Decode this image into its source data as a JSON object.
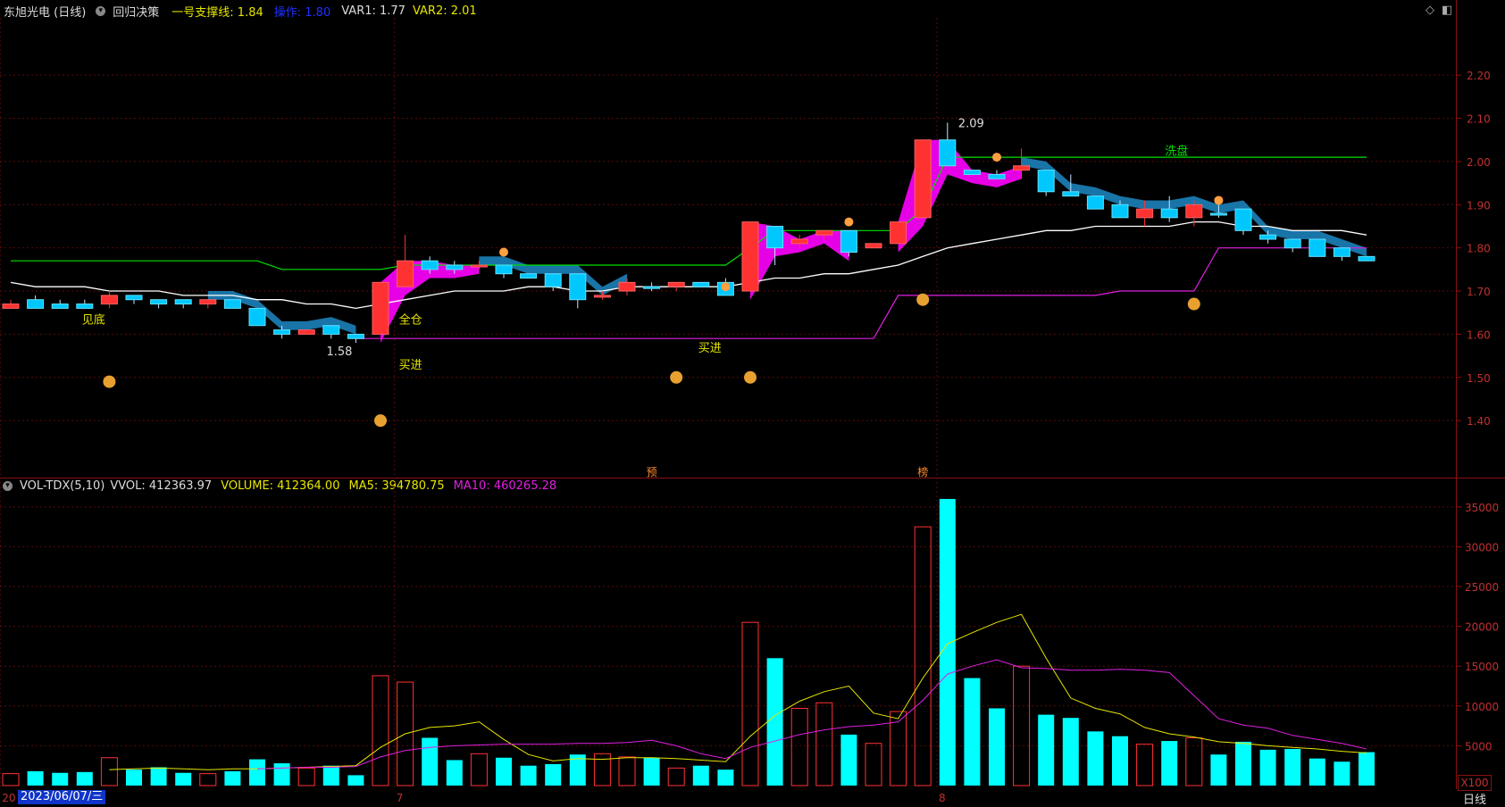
{
  "top_header": {
    "stock_name": "东旭光电 (日线)",
    "indicator": "回归决策",
    "support_label": "一号支撑线: 1.84",
    "operate_label": "操作: 1.80",
    "var1_label": "VAR1: 1.77",
    "var2_label": "VAR2: 2.01"
  },
  "bottom_header": {
    "indicator": "VOL-TDX(5,10)",
    "vvol_label": "VVOL: 412363.97",
    "volume_label": "VOLUME: 412364.00",
    "ma5_label": "MA5: 394780.75",
    "ma10_label": "MA10: 460265.28"
  },
  "price_axis": [
    "2.20",
    "2.10",
    "2.00",
    "1.90",
    "1.80",
    "1.70",
    "1.60",
    "1.50",
    "1.40"
  ],
  "volume_axis": [
    "35000",
    "30000",
    "25000",
    "20000",
    "15000",
    "10000",
    "5000"
  ],
  "annotations": {
    "high_label": "2.09",
    "low_label": "1.58",
    "see_bottom": "见底",
    "full_position": "全仓",
    "buy_in_1": "买进",
    "buy_in_2": "买进",
    "wash": "洗盘",
    "pre_marker": "预",
    "list_marker": "榜"
  },
  "month_marks": [
    "20",
    "7",
    "8"
  ],
  "cursor_date": "2023/06/07/三",
  "scale_label": "X100",
  "period_label": "日线",
  "colors": {
    "up": "#ff3232",
    "down": "#00c8ff",
    "ma5": "#e6e600",
    "ma10": "#e020e0",
    "support": "#00e000",
    "var": "#ffffff",
    "fill": "#ff00ff",
    "band": "#1a7ab0"
  },
  "chart_data": [
    {
      "type": "candlestick",
      "title": "",
      "ylim": [
        1.33,
        2.25
      ],
      "candles": [
        {
          "o": 1.66,
          "h": 1.68,
          "l": 1.66,
          "c": 1.67,
          "up": true
        },
        {
          "o": 1.68,
          "h": 1.69,
          "l": 1.66,
          "c": 1.66,
          "up": false
        },
        {
          "o": 1.67,
          "h": 1.68,
          "l": 1.66,
          "c": 1.66,
          "up": false
        },
        {
          "o": 1.67,
          "h": 1.68,
          "l": 1.66,
          "c": 1.66,
          "up": false
        },
        {
          "o": 1.67,
          "h": 1.7,
          "l": 1.66,
          "c": 1.69,
          "up": true
        },
        {
          "o": 1.69,
          "h": 1.69,
          "l": 1.67,
          "c": 1.68,
          "up": false
        },
        {
          "o": 1.68,
          "h": 1.68,
          "l": 1.66,
          "c": 1.67,
          "up": false
        },
        {
          "o": 1.68,
          "h": 1.68,
          "l": 1.66,
          "c": 1.67,
          "up": false
        },
        {
          "o": 1.67,
          "h": 1.68,
          "l": 1.66,
          "c": 1.68,
          "up": true
        },
        {
          "o": 1.68,
          "h": 1.68,
          "l": 1.66,
          "c": 1.66,
          "up": false
        },
        {
          "o": 1.66,
          "h": 1.66,
          "l": 1.62,
          "c": 1.62,
          "up": false
        },
        {
          "o": 1.61,
          "h": 1.62,
          "l": 1.59,
          "c": 1.6,
          "up": false
        },
        {
          "o": 1.6,
          "h": 1.61,
          "l": 1.6,
          "c": 1.61,
          "up": true
        },
        {
          "o": 1.62,
          "h": 1.62,
          "l": 1.59,
          "c": 1.6,
          "up": false
        },
        {
          "o": 1.6,
          "h": 1.6,
          "l": 1.58,
          "c": 1.59,
          "up": false
        },
        {
          "o": 1.6,
          "h": 1.72,
          "l": 1.6,
          "c": 1.72,
          "up": true
        },
        {
          "o": 1.71,
          "h": 1.83,
          "l": 1.71,
          "c": 1.77,
          "up": true
        },
        {
          "o": 1.77,
          "h": 1.78,
          "l": 1.74,
          "c": 1.75,
          "up": false
        },
        {
          "o": 1.76,
          "h": 1.77,
          "l": 1.74,
          "c": 1.75,
          "up": false
        },
        {
          "o": 1.76,
          "h": 1.77,
          "l": 1.75,
          "c": 1.76,
          "up": true
        },
        {
          "o": 1.76,
          "h": 1.76,
          "l": 1.73,
          "c": 1.74,
          "up": false
        },
        {
          "o": 1.74,
          "h": 1.74,
          "l": 1.73,
          "c": 1.73,
          "up": false
        },
        {
          "o": 1.74,
          "h": 1.74,
          "l": 1.7,
          "c": 1.71,
          "up": false
        },
        {
          "o": 1.74,
          "h": 1.74,
          "l": 1.66,
          "c": 1.68,
          "up": false
        },
        {
          "o": 1.69,
          "h": 1.7,
          "l": 1.68,
          "c": 1.69,
          "up": true
        },
        {
          "o": 1.7,
          "h": 1.73,
          "l": 1.69,
          "c": 1.72,
          "up": true
        },
        {
          "o": 1.71,
          "h": 1.72,
          "l": 1.7,
          "c": 1.71,
          "up": false
        },
        {
          "o": 1.71,
          "h": 1.72,
          "l": 1.7,
          "c": 1.72,
          "up": true
        },
        {
          "o": 1.72,
          "h": 1.72,
          "l": 1.71,
          "c": 1.71,
          "up": false
        },
        {
          "o": 1.72,
          "h": 1.73,
          "l": 1.69,
          "c": 1.69,
          "up": false
        },
        {
          "o": 1.7,
          "h": 1.86,
          "l": 1.7,
          "c": 1.86,
          "up": true
        },
        {
          "o": 1.85,
          "h": 1.85,
          "l": 1.76,
          "c": 1.8,
          "up": false
        },
        {
          "o": 1.81,
          "h": 1.83,
          "l": 1.8,
          "c": 1.82,
          "up": true
        },
        {
          "o": 1.83,
          "h": 1.84,
          "l": 1.82,
          "c": 1.84,
          "up": true
        },
        {
          "o": 1.84,
          "h": 1.84,
          "l": 1.78,
          "c": 1.79,
          "up": false
        },
        {
          "o": 1.8,
          "h": 1.81,
          "l": 1.8,
          "c": 1.81,
          "up": true
        },
        {
          "o": 1.81,
          "h": 1.86,
          "l": 1.81,
          "c": 1.86,
          "up": true
        },
        {
          "o": 1.87,
          "h": 2.05,
          "l": 1.87,
          "c": 2.05,
          "up": true
        },
        {
          "o": 2.05,
          "h": 2.09,
          "l": 1.99,
          "c": 1.99,
          "up": false
        },
        {
          "o": 1.98,
          "h": 1.98,
          "l": 1.97,
          "c": 1.97,
          "up": false
        },
        {
          "o": 1.97,
          "h": 1.98,
          "l": 1.96,
          "c": 1.96,
          "up": false
        },
        {
          "o": 1.99,
          "h": 2.03,
          "l": 1.96,
          "c": 1.98,
          "up": true
        },
        {
          "o": 1.98,
          "h": 1.98,
          "l": 1.92,
          "c": 1.93,
          "up": false
        },
        {
          "o": 1.93,
          "h": 1.97,
          "l": 1.92,
          "c": 1.92,
          "up": false
        },
        {
          "o": 1.92,
          "h": 1.92,
          "l": 1.89,
          "c": 1.89,
          "up": false
        },
        {
          "o": 1.9,
          "h": 1.91,
          "l": 1.87,
          "c": 1.87,
          "up": false
        },
        {
          "o": 1.89,
          "h": 1.91,
          "l": 1.85,
          "c": 1.87,
          "up": true
        },
        {
          "o": 1.89,
          "h": 1.92,
          "l": 1.86,
          "c": 1.87,
          "up": false
        },
        {
          "o": 1.9,
          "h": 1.91,
          "l": 1.85,
          "c": 1.87,
          "up": true
        },
        {
          "o": 1.88,
          "h": 1.9,
          "l": 1.87,
          "c": 1.88,
          "up": false
        },
        {
          "o": 1.89,
          "h": 1.89,
          "l": 1.83,
          "c": 1.84,
          "up": false
        },
        {
          "o": 1.83,
          "h": 1.84,
          "l": 1.81,
          "c": 1.82,
          "up": false
        },
        {
          "o": 1.82,
          "h": 1.82,
          "l": 1.79,
          "c": 1.8,
          "up": false
        },
        {
          "o": 1.82,
          "h": 1.82,
          "l": 1.78,
          "c": 1.78,
          "up": false
        },
        {
          "o": 1.8,
          "h": 1.8,
          "l": 1.77,
          "c": 1.78,
          "up": false
        },
        {
          "o": 1.78,
          "h": 1.78,
          "l": 1.77,
          "c": 1.77,
          "up": false
        }
      ],
      "support_line": [
        1.77,
        1.77,
        1.77,
        1.77,
        1.77,
        1.77,
        1.77,
        1.77,
        1.77,
        1.77,
        1.77,
        1.75,
        1.75,
        1.75,
        1.75,
        1.75,
        1.76,
        1.76,
        1.76,
        1.76,
        1.76,
        1.76,
        1.76,
        1.76,
        1.76,
        1.76,
        1.76,
        1.76,
        1.76,
        1.76,
        1.8,
        1.84,
        1.84,
        1.84,
        1.84,
        1.84,
        1.84,
        1.89,
        2.01,
        2.01,
        2.01,
        2.01,
        2.01,
        2.01,
        2.01,
        2.01,
        2.01,
        2.01,
        2.01,
        2.01,
        2.01,
        2.01,
        2.01,
        2.01,
        2.01,
        2.01
      ],
      "operate_line": [
        1.72,
        1.71,
        1.71,
        1.71,
        1.7,
        1.7,
        1.7,
        1.69,
        1.69,
        1.69,
        1.68,
        1.68,
        1.67,
        1.67,
        1.66,
        1.67,
        1.68,
        1.69,
        1.7,
        1.7,
        1.7,
        1.71,
        1.71,
        1.7,
        1.7,
        1.71,
        1.71,
        1.71,
        1.71,
        1.71,
        1.72,
        1.73,
        1.73,
        1.74,
        1.74,
        1.75,
        1.76,
        1.78,
        1.8,
        1.81,
        1.82,
        1.83,
        1.84,
        1.84,
        1.85,
        1.85,
        1.85,
        1.85,
        1.86,
        1.86,
        1.85,
        1.85,
        1.84,
        1.84,
        1.84,
        1.83
      ],
      "bottom_line": [
        null,
        null,
        null,
        null,
        null,
        null,
        null,
        null,
        null,
        null,
        null,
        null,
        null,
        null,
        1.59,
        1.59,
        1.59,
        1.59,
        1.59,
        1.59,
        1.59,
        1.59,
        1.59,
        1.59,
        1.59,
        1.59,
        1.59,
        1.59,
        1.59,
        1.59,
        1.59,
        1.59,
        1.59,
        1.59,
        1.59,
        1.59,
        1.69,
        1.69,
        1.69,
        1.69,
        1.69,
        1.69,
        1.69,
        1.69,
        1.69,
        1.7,
        1.7,
        1.7,
        1.7,
        1.8,
        1.8,
        1.8,
        1.8,
        1.8,
        1.8,
        1.8
      ]
    },
    {
      "type": "bar",
      "title": "VOL-TDX(5,10)",
      "ylim": [
        0,
        37000
      ],
      "volume": [
        1500,
        1800,
        1600,
        1700,
        3500,
        2000,
        2300,
        1600,
        1500,
        1800,
        3300,
        2800,
        2200,
        2500,
        1300,
        13800,
        13000,
        6000,
        3200,
        4000,
        3500,
        2500,
        2700,
        3900,
        4000,
        3600,
        3500,
        2200,
        2500,
        2000,
        20500,
        16000,
        9700,
        10400,
        6400,
        5300,
        9300,
        32500,
        36000,
        13500,
        9700,
        15000,
        8900,
        8500,
        6800,
        6200,
        5200,
        5600,
        6000,
        3900,
        5500,
        4500,
        4600,
        3400,
        3000,
        4200
      ],
      "ma5": [
        null,
        null,
        null,
        null,
        2000,
        2100,
        2200,
        2100,
        2000,
        2100,
        2100,
        2200,
        2300,
        2400,
        2500,
        4800,
        6500,
        7300,
        7500,
        8000,
        5800,
        3900,
        3100,
        3400,
        3300,
        3500,
        3500,
        3400,
        3200,
        3000,
        6200,
        8800,
        10600,
        11800,
        12500,
        9100,
        8400,
        13500,
        17800,
        19200,
        20500,
        21500,
        16000,
        11000,
        9700,
        9000,
        7300,
        6500,
        6100,
        5500,
        5300,
        5000,
        4800,
        4600,
        4300,
        4100
      ],
      "ma10": [
        null,
        null,
        null,
        null,
        null,
        null,
        null,
        null,
        null,
        null,
        2100,
        2200,
        2300,
        2300,
        2400,
        3600,
        4400,
        4800,
        5000,
        5100,
        5200,
        5200,
        5200,
        5300,
        5300,
        5400,
        5700,
        5000,
        4000,
        3400,
        4800,
        5600,
        6400,
        7000,
        7400,
        7600,
        8000,
        10700,
        14000,
        15000,
        15800,
        14800,
        14700,
        14500,
        14500,
        14600,
        14500,
        14200,
        11300,
        8400,
        7600,
        7200,
        6300,
        5800,
        5300,
        4600
      ]
    }
  ]
}
